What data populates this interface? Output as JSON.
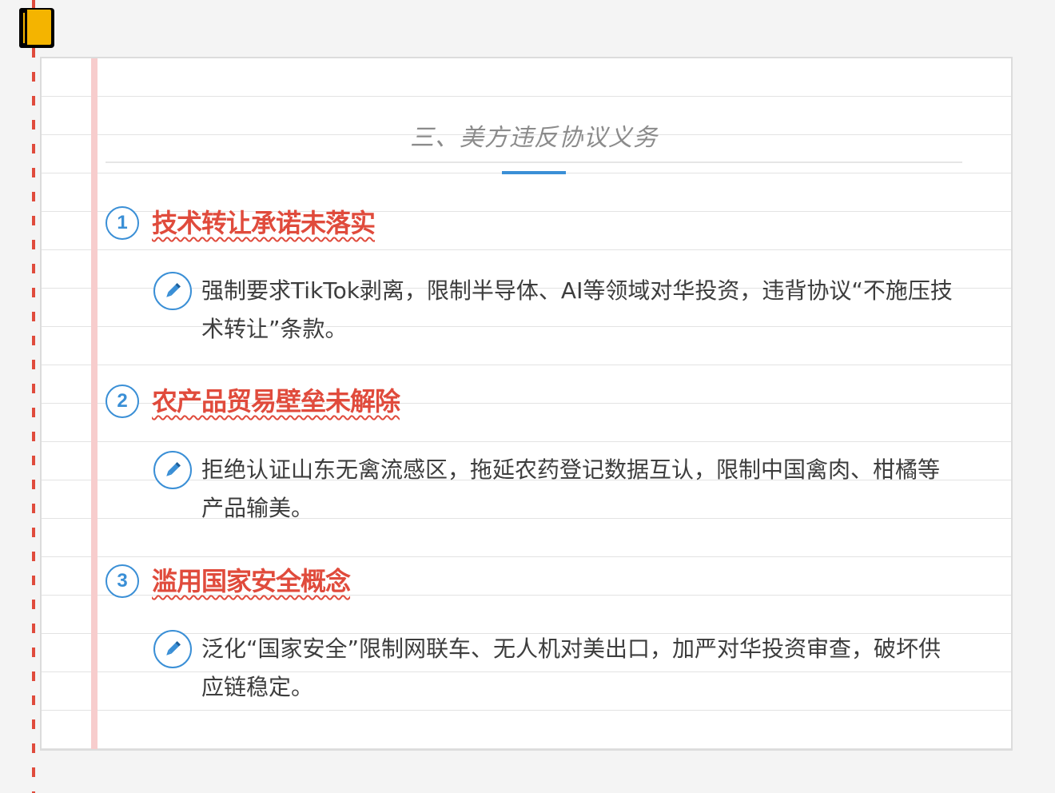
{
  "section": {
    "title": "三、美方违反协议义务"
  },
  "points": [
    {
      "number": "1",
      "title": "技术转让承诺未落实",
      "body": "强制要求TikTok剥离，限制半导体、AI等领域对华投资，违背协议“不施压技术转让”条款。"
    },
    {
      "number": "2",
      "title": "农产品贸易壁垒未解除",
      "body": "拒绝认证山东无禽流感区，拖延农药登记数据互认，限制中国禽肉、柑橘等产品输美。"
    },
    {
      "number": "3",
      "title": "滥用国家安全概念",
      "body": "泛化“国家安全”限制网联车、无人机对美出口，加严对华投资审查，破坏供应链稳定。"
    }
  ],
  "colors": {
    "accent_blue": "#3a8fd6",
    "heading_red": "#e04b3c",
    "margin_pink": "#f7cdcd",
    "book_yellow": "#f4b400"
  },
  "icons": {
    "notebook": "notebook-icon",
    "pencil": "pencil-icon"
  }
}
